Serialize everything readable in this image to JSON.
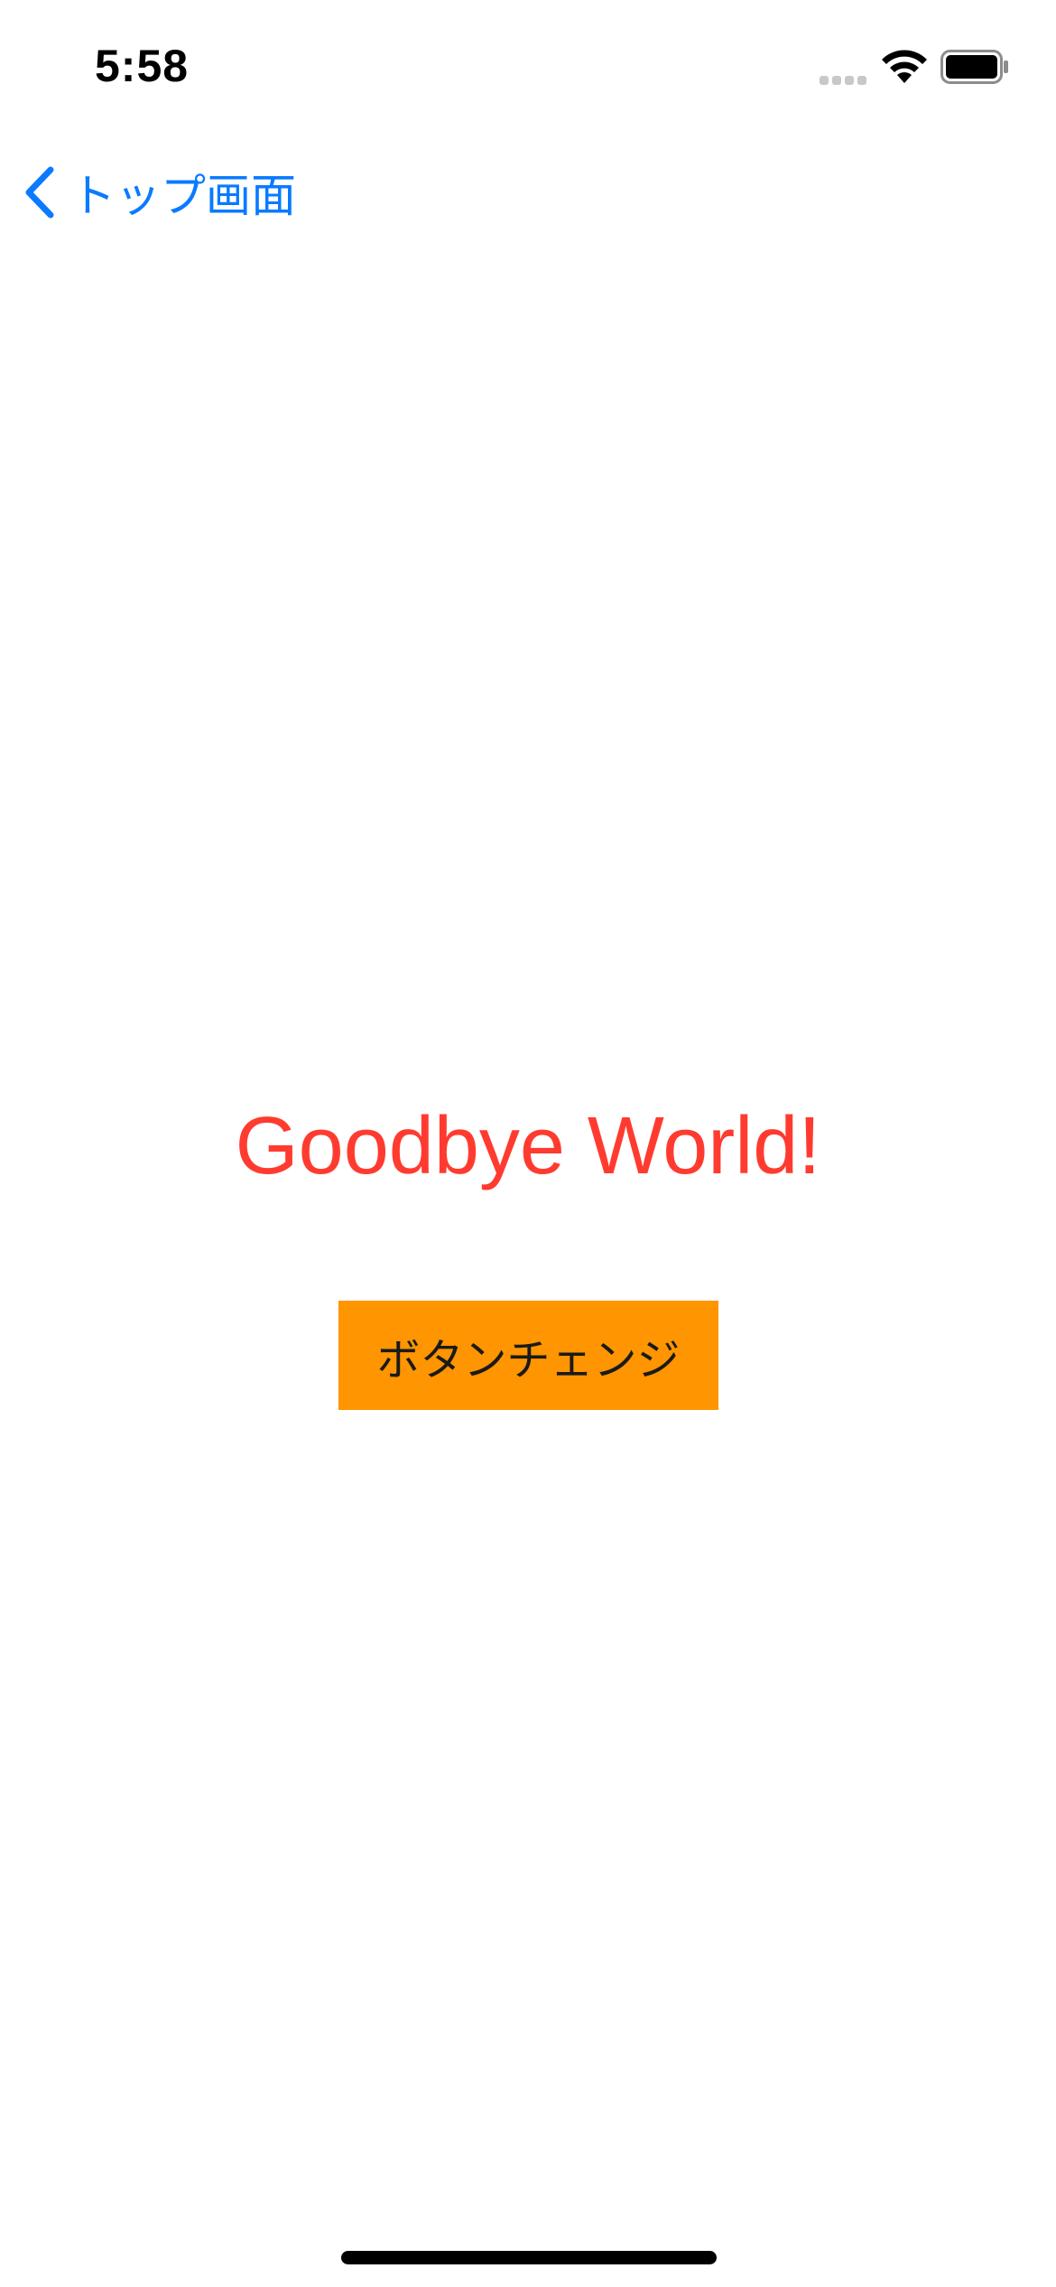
{
  "status_bar": {
    "time": "5:58",
    "icons": [
      "signal-icon",
      "wifi-icon",
      "battery-icon"
    ]
  },
  "nav_bar": {
    "back_label": "トップ画面",
    "back_icon": "chevron-left-icon"
  },
  "main": {
    "headline": "Goodbye World!",
    "button_label": "ボタンチェンジ"
  },
  "colors": {
    "accent_blue": "#0a7aff",
    "headline_red": "#ff3b30",
    "button_orange": "#ff9500",
    "background": "#ffffff"
  }
}
